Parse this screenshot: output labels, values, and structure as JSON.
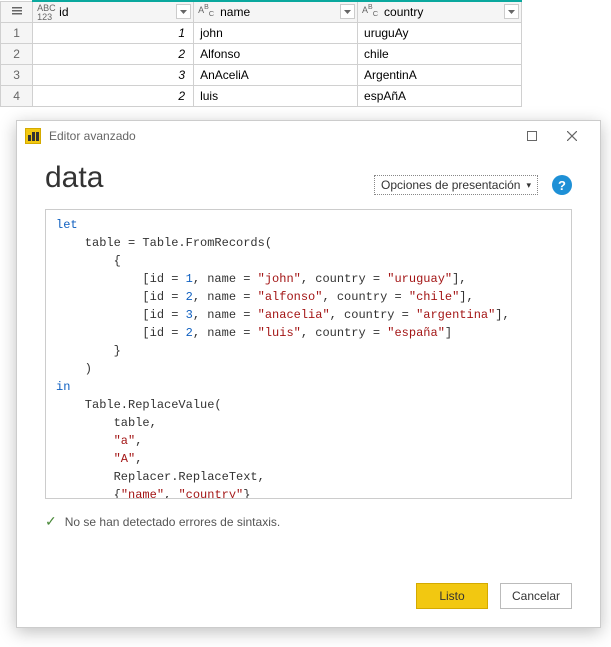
{
  "grid": {
    "columns": [
      {
        "name": "id",
        "type": "ABC123"
      },
      {
        "name": "name",
        "type": "ABC"
      },
      {
        "name": "country",
        "type": "ABC"
      }
    ],
    "rows": [
      {
        "n": "1",
        "id": "1",
        "name": "john",
        "country": "uruguAy"
      },
      {
        "n": "2",
        "id": "2",
        "name": "Alfonso",
        "country": "chile"
      },
      {
        "n": "3",
        "id": "3",
        "name": "AnAceliA",
        "country": "ArgentinA"
      },
      {
        "n": "4",
        "id": "2",
        "name": "luis",
        "country": "espAñA"
      }
    ]
  },
  "editor": {
    "window_title": "Editor avanzado",
    "heading": "data",
    "options_label": "Opciones de presentación",
    "help_label": "?",
    "status_text": "No se han detectado errores de sintaxis.",
    "done_label": "Listo",
    "cancel_label": "Cancelar",
    "code": {
      "kw_let": "let",
      "kw_in": "in",
      "l1a": "    table = Table.FromRecords(",
      "l2": "        {",
      "l3a": "            [id = ",
      "l3n": "1",
      "l3b": ", name = ",
      "l3s1": "\"john\"",
      "l3c": ", country = ",
      "l3s2": "\"uruguay\"",
      "l3d": "],",
      "l4a": "            [id = ",
      "l4n": "2",
      "l4b": ", name = ",
      "l4s1": "\"alfonso\"",
      "l4c": ", country = ",
      "l4s2": "\"chile\"",
      "l4d": "],",
      "l5a": "            [id = ",
      "l5n": "3",
      "l5b": ", name = ",
      "l5s1": "\"anacelia\"",
      "l5c": ", country = ",
      "l5s2": "\"argentina\"",
      "l5d": "],",
      "l6a": "            [id = ",
      "l6n": "2",
      "l6b": ", name = ",
      "l6s1": "\"luis\"",
      "l6c": ", country = ",
      "l6s2": "\"españa\"",
      "l6d": "]",
      "l7": "        }",
      "l8": "    )",
      "l9": "    Table.ReplaceValue(",
      "l10": "        table,",
      "l11a": "        ",
      "l11s": "\"a\"",
      "l11b": ",",
      "l12a": "        ",
      "l12s": "\"A\"",
      "l12b": ",",
      "l13": "        Replacer.ReplaceText,",
      "l14a": "        {",
      "l14s1": "\"name\"",
      "l14b": ", ",
      "l14s2": "\"country\"",
      "l14c": "}",
      "l15": "    )"
    }
  }
}
